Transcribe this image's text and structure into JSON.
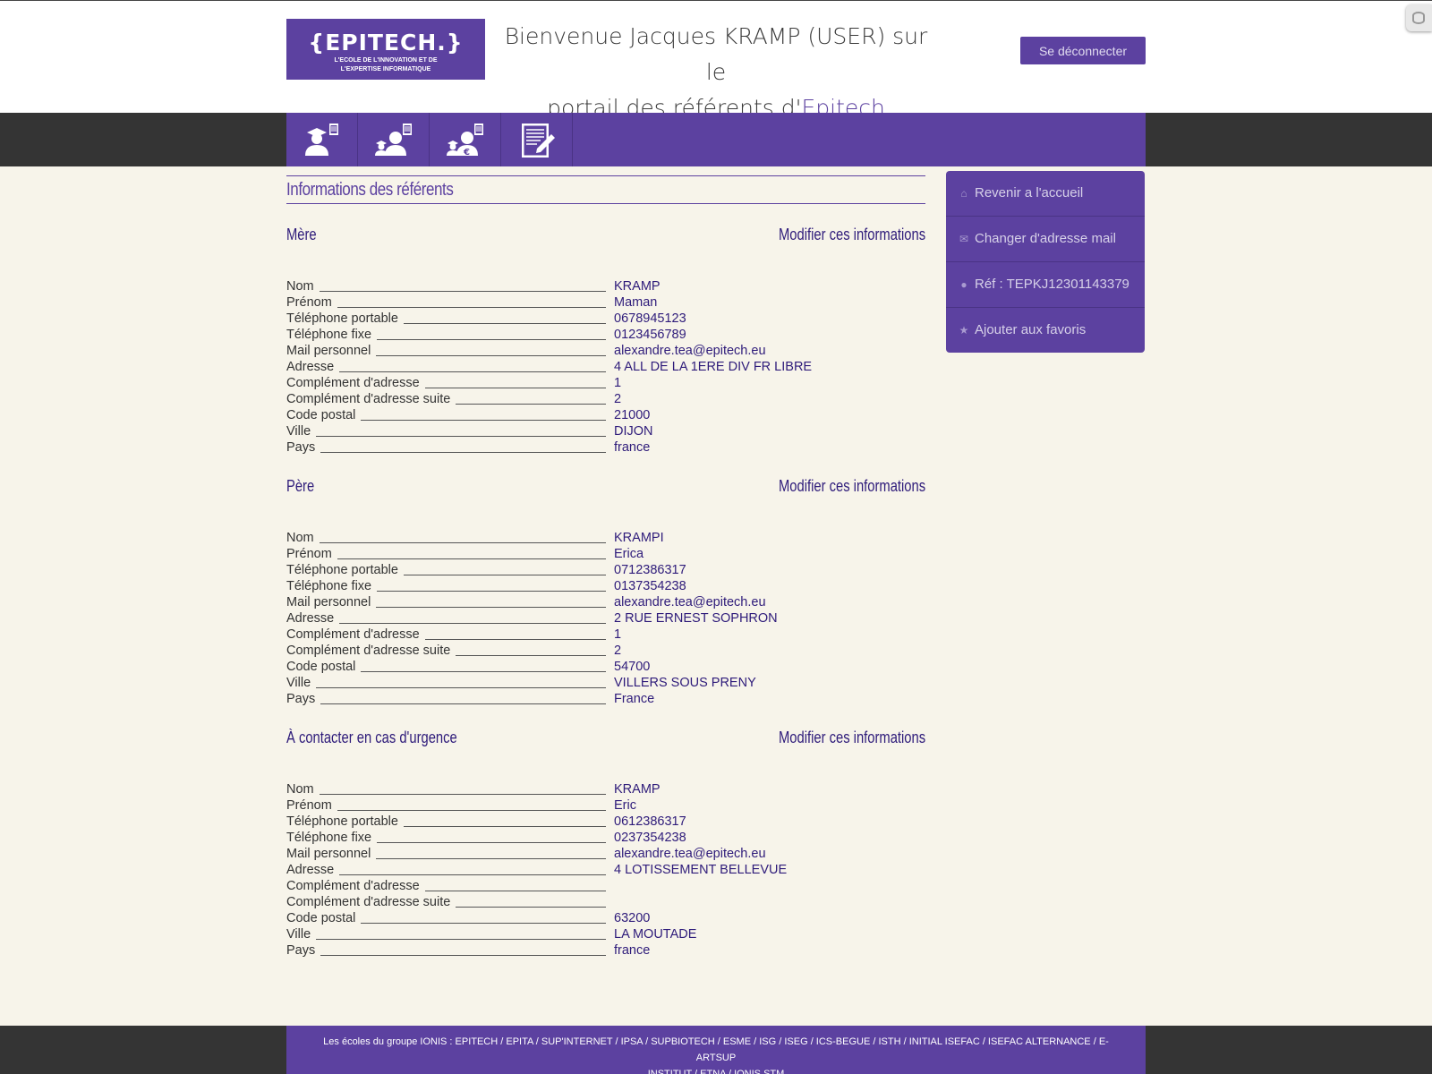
{
  "header": {
    "logo_brand": "{EPITECH.}",
    "logo_tagline_1": "L'ECOLE DE L'INNOVATION ET DE",
    "logo_tagline_2": "L'EXPERTISE INFORMATIQUE",
    "welcome_line1": "Bienvenue Jacques KRAMP (USER) sur le",
    "welcome_line2_prefix": "portail des référents d'",
    "welcome_line2_accent": "Epitech",
    "logout_label": "Se déconnecter"
  },
  "nav": {
    "items": [
      {
        "icon": "student-document-icon"
      },
      {
        "icon": "parent-student-document-icon"
      },
      {
        "icon": "parent-student-euro-icon"
      },
      {
        "icon": "edit-document-icon"
      }
    ]
  },
  "page_title": "Informations des référents",
  "modify_label": "Modifier ces informations",
  "field_labels": {
    "nom": "Nom",
    "prenom": "Prénom",
    "tel_portable": "Téléphone portable",
    "tel_fixe": "Téléphone fixe",
    "mail": "Mail personnel",
    "adresse": "Adresse",
    "complement": "Complément d'adresse",
    "complement_suite": "Complément d'adresse suite",
    "code_postal": "Code postal",
    "ville": "Ville",
    "pays": "Pays"
  },
  "sections": [
    {
      "title": "Mère",
      "values": {
        "nom": "KRAMP",
        "prenom": "Maman",
        "tel_portable": "0678945123",
        "tel_fixe": "0123456789",
        "mail": "alexandre.tea@epitech.eu",
        "adresse": "4 ALL DE LA 1ERE DIV FR LIBRE",
        "complement": "1",
        "complement_suite": "2",
        "code_postal": "21000",
        "ville": "DIJON",
        "pays": "france"
      }
    },
    {
      "title": "Père",
      "values": {
        "nom": "KRAMPI",
        "prenom": "Erica",
        "tel_portable": "0712386317",
        "tel_fixe": "0137354238",
        "mail": "alexandre.tea@epitech.eu",
        "adresse": "2 RUE ERNEST SOPHRON",
        "complement": "1",
        "complement_suite": "2",
        "code_postal": "54700",
        "ville": "VILLERS SOUS PRENY",
        "pays": "France"
      }
    },
    {
      "title": "À contacter en cas d'urgence",
      "values": {
        "nom": "KRAMP",
        "prenom": "Eric",
        "tel_portable": "0612386317",
        "tel_fixe": "0237354238",
        "mail": "alexandre.tea@epitech.eu",
        "adresse": "4 LOTISSEMENT BELLEVUE",
        "complement": "",
        "complement_suite": "",
        "code_postal": "63200",
        "ville": "LA MOUTADE",
        "pays": "france"
      }
    }
  ],
  "sidebar": {
    "items": [
      {
        "label": "Revenir a l'accueil",
        "icon": "home-icon"
      },
      {
        "label": "Changer d'adresse mail",
        "icon": "mail-icon"
      },
      {
        "label": "Réf : TEPKJ12301143379",
        "icon": "user-icon"
      },
      {
        "label": "Ajouter aux favoris",
        "icon": "star-icon"
      }
    ]
  },
  "footer": {
    "line1": "Les écoles du groupe IONIS : EPITECH / EPITA / SUP'INTERNET / IPSA / SUPBIOTECH / ESME / ISG / ISEG / ICS-BEGUE / ISTH / INITIAL ISEFAC / ISEFAC ALTERNANCE / E-ARTSUP",
    "line2": "INSTITUT / ETNA / IONIS STM"
  },
  "colors": {
    "brand_purple": "#5c41a0",
    "text_purple": "#2e1b7a",
    "background": "#f7f4ea",
    "dark_bar": "#343434"
  }
}
